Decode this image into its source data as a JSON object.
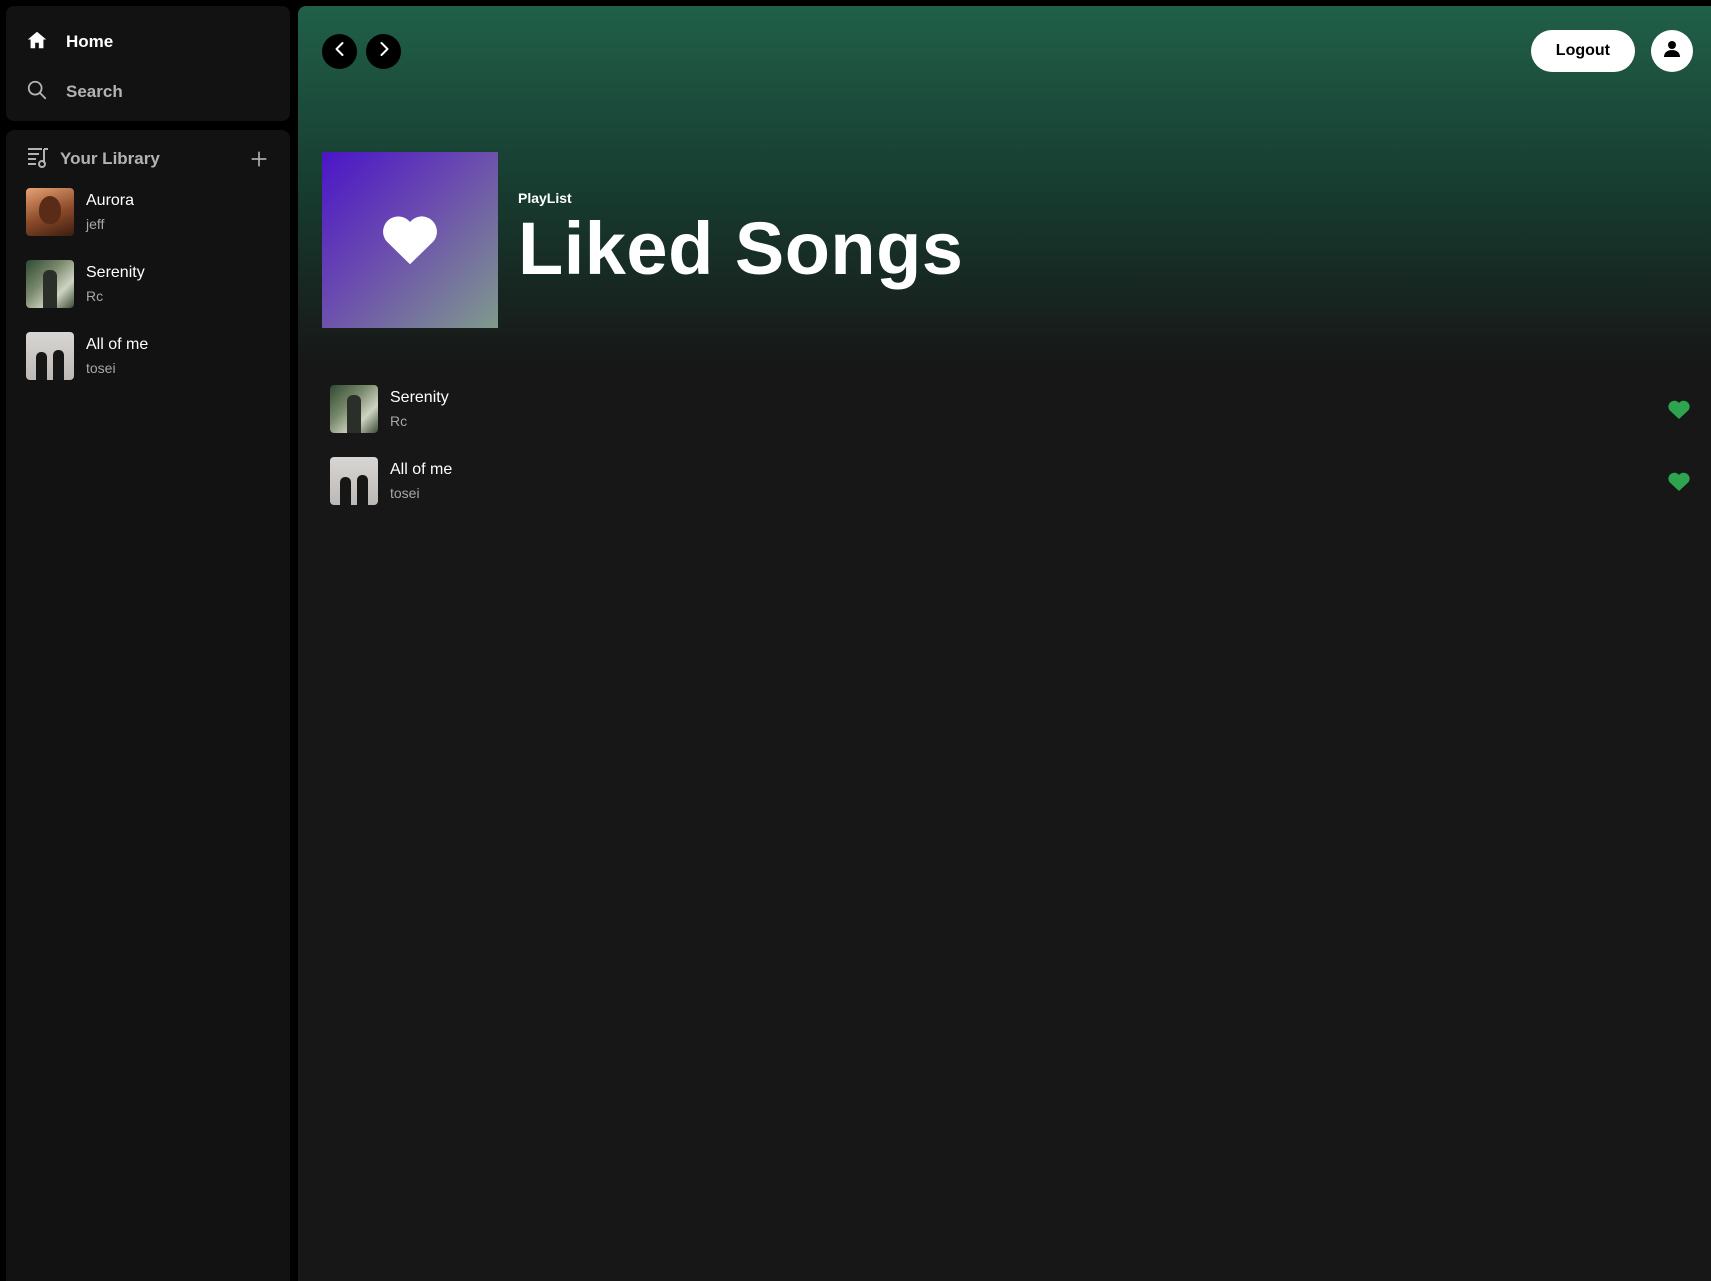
{
  "nav": {
    "home_label": "Home",
    "search_label": "Search"
  },
  "library": {
    "title": "Your Library",
    "items": [
      {
        "title": "Aurora",
        "artist": "jeff"
      },
      {
        "title": "Serenity",
        "artist": "Rc"
      },
      {
        "title": "All of me",
        "artist": "tosei"
      }
    ]
  },
  "topbar": {
    "logout_label": "Logout"
  },
  "playlist": {
    "kind": "PlayList",
    "title": "Liked Songs",
    "tracks": [
      {
        "title": "Serenity",
        "artist": "Rc",
        "liked": true
      },
      {
        "title": "All of me",
        "artist": "tosei",
        "liked": true
      }
    ]
  },
  "colors": {
    "accent_green": "#1db954",
    "liked_heart": "#2ea44f"
  }
}
